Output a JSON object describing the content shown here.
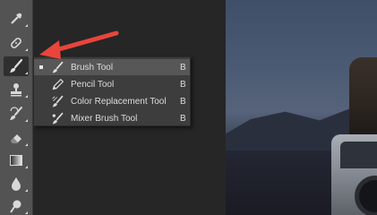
{
  "toolbar": {
    "tools": [
      {
        "name": "eyedropper-tool",
        "icon": "eyedropper-icon"
      },
      {
        "name": "spot-healing-tool",
        "icon": "band-aid-icon"
      },
      {
        "name": "brush-tool",
        "icon": "brush-icon",
        "active": true
      },
      {
        "name": "clone-stamp-tool",
        "icon": "stamp-icon"
      },
      {
        "name": "history-brush-tool",
        "icon": "history-brush-icon"
      },
      {
        "name": "eraser-tool",
        "icon": "eraser-icon"
      },
      {
        "name": "gradient-tool",
        "icon": "gradient-icon"
      },
      {
        "name": "blur-tool",
        "icon": "drop-icon"
      },
      {
        "name": "dodge-tool",
        "icon": "dodge-icon"
      }
    ]
  },
  "flyout": {
    "items": [
      {
        "label": "Brush Tool",
        "key": "B",
        "icon": "brush-icon",
        "selected": true
      },
      {
        "label": "Pencil Tool",
        "key": "B",
        "icon": "pencil-icon",
        "selected": false
      },
      {
        "label": "Color Replacement Tool",
        "key": "B",
        "icon": "color-replacement-icon",
        "selected": false
      },
      {
        "label": "Mixer Brush Tool",
        "key": "B",
        "icon": "mixer-brush-icon",
        "selected": false
      }
    ]
  },
  "colors": {
    "toolbar_bg": "#535353",
    "flyout_bg": "#3d3d3d",
    "flyout_selected": "#575757",
    "annotation_arrow": "#e8453c"
  }
}
